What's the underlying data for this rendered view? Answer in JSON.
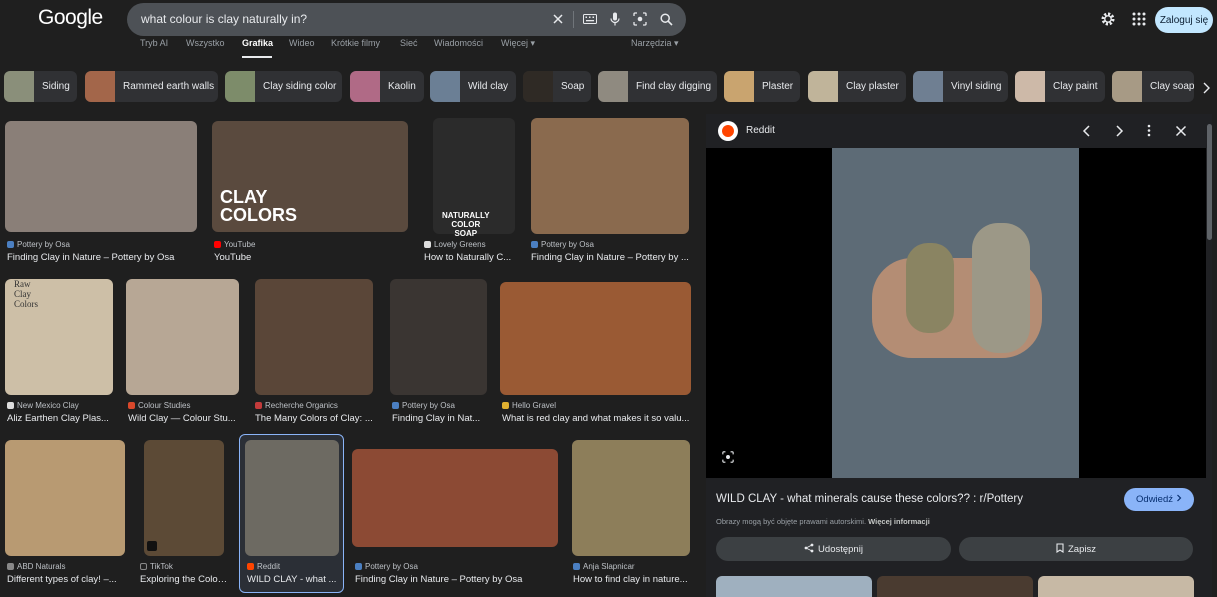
{
  "header": {
    "logo": "Google",
    "query": "what colour is clay naturally in?",
    "login_label": "Zaloguj się"
  },
  "tabs": [
    {
      "label": "Tryb AI"
    },
    {
      "label": "Wszystko"
    },
    {
      "label": "Grafika",
      "active": true
    },
    {
      "label": "Wideo"
    },
    {
      "label": "Krótkie filmy"
    },
    {
      "label": "Sieć"
    },
    {
      "label": "Wiadomości"
    },
    {
      "label": "Więcej ▾"
    }
  ],
  "tools_label": "Narzędzia ▾",
  "chips": [
    {
      "label": "Siding",
      "color": "#8a8f7a"
    },
    {
      "label": "Rammed earth walls",
      "color": "#a3664a"
    },
    {
      "label": "Clay siding color",
      "color": "#7d8c6a"
    },
    {
      "label": "Kaolin",
      "color": "#b06a86"
    },
    {
      "label": "Wild clay",
      "color": "#6b7f95"
    },
    {
      "label": "Soap",
      "color": "#2f2a25"
    },
    {
      "label": "Find clay digging",
      "color": "#8f8a80"
    },
    {
      "label": "Plaster",
      "color": "#c9a46f"
    },
    {
      "label": "Clay plaster",
      "color": "#c0b49a"
    },
    {
      "label": "Vinyl siding",
      "color": "#6f7f92"
    },
    {
      "label": "Clay paint",
      "color": "#cdb9a8"
    },
    {
      "label": "Clay soap",
      "color": "#a79a85"
    }
  ],
  "results": [
    {
      "source": "Pottery by Osa",
      "title": "Finding Clay in Nature – Pottery by Osa",
      "color": "#8a7f78",
      "fav": "#4b7fc1"
    },
    {
      "source": "YouTube",
      "title": "YouTube",
      "color": "#5a4a3e",
      "fav": "#ff0000",
      "overlay": "CLAY\nCOLORS"
    },
    {
      "source": "Lovely Greens",
      "title": "How to Naturally C...",
      "color": "#2b2b2b",
      "fav": "#dddddd",
      "overlay": "NATURALLY\nCOLOR SOAP"
    },
    {
      "source": "Pottery by Osa",
      "title": "Finding Clay in Nature – Pottery by ...",
      "color": "#8a6a4e",
      "fav": "#4b7fc1"
    },
    {
      "source": "New Mexico Clay",
      "title": "Aliz Earthen Clay Plas...",
      "color": "#cdbfa7",
      "fav": "#dddddd",
      "overlay": "Raw Clay Colors"
    },
    {
      "source": "Colour Studies",
      "title": "Wild Clay — Colour Stu...",
      "color": "#b7a795",
      "fav": "#d9482b"
    },
    {
      "source": "Recherche Organics",
      "title": "The Many Colors of Clay: ...",
      "color": "#5a4638",
      "fav": "#c33b3b"
    },
    {
      "source": "Pottery by Osa",
      "title": "Finding Clay in Nat...",
      "color": "#3a3532",
      "fav": "#4b7fc1"
    },
    {
      "source": "Hello Gravel",
      "title": "What is red clay and what makes it so valu...",
      "color": "#9a5a34",
      "fav": "#e0b030"
    },
    {
      "source": "ABD Naturals",
      "title": "Different types of clay! –...",
      "color": "#b89a72",
      "fav": "#888888"
    },
    {
      "source": "TikTok",
      "title": "Exploring the Color...",
      "color": "#5c4a36",
      "fav": "#222222"
    },
    {
      "source": "Reddit",
      "title": "WILD CLAY - what ...",
      "color": "#6d6a62",
      "fav": "#ff4500"
    },
    {
      "source": "Pottery by Osa",
      "title": "Finding Clay in Nature – Pottery by Osa",
      "color": "#8c4a34",
      "fav": "#4b7fc1"
    },
    {
      "source": "Anja Slapnicar",
      "title": "How to find clay in nature...",
      "color": "#8d7e5a",
      "fav": "#4b7fc1"
    }
  ],
  "panel": {
    "source": "Reddit",
    "title": "WILD CLAY - what minerals cause these colors?? : r/Pottery",
    "visit_label": "Odwiedź",
    "copyright": "Obrazy mogą być objęte prawami autorskimi.",
    "more_info": "Więcej informacji",
    "share_label": "Udostępnij",
    "save_label": "Zapisz"
  }
}
